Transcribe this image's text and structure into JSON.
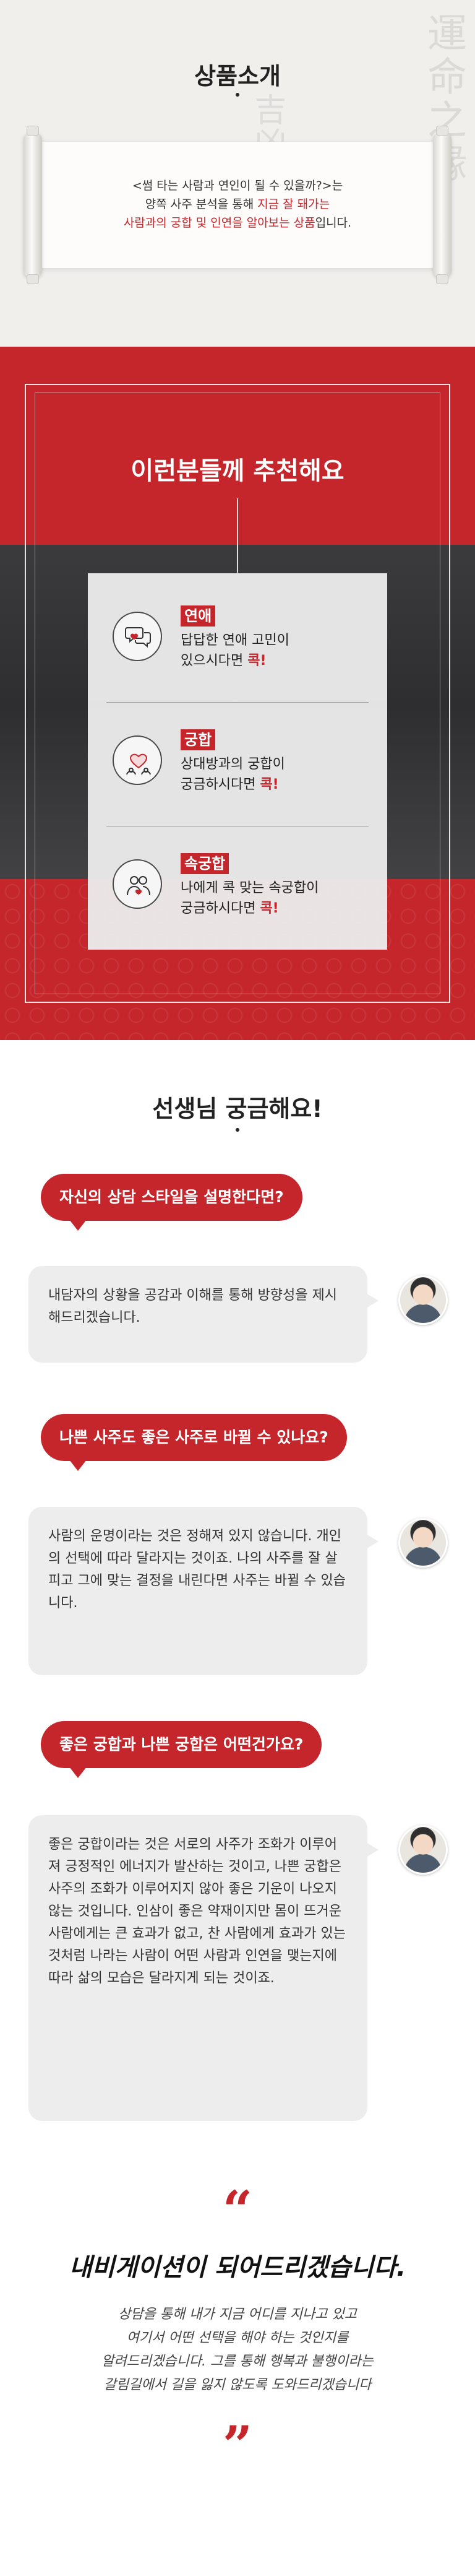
{
  "intro": {
    "title": "상품소개",
    "line1": "<썸 타는 사람과 연인이 될 수 있을까?>는",
    "line2_prefix": "양쪽 사주 분석을 통해 ",
    "line2_highlight": "지금 잘 돼가는",
    "line3_highlight": "사람과의 궁합 및 인연을 알아보는 상품",
    "line3_suffix": "입니다."
  },
  "recommend": {
    "title": "이런분들께 추천해요",
    "items": [
      {
        "label": "연애",
        "line1": "답답한 연애 고민이",
        "line2_prefix": "있으시다면 ",
        "line2_highlight": "콕!"
      },
      {
        "label": "궁합",
        "line1": "상대방과의 궁합이",
        "line2_prefix": "궁금하시다면 ",
        "line2_highlight": "콕!"
      },
      {
        "label": "속궁합",
        "line1": "나에게 콕 맞는 속궁합이",
        "line2_prefix": "궁금하시다면 ",
        "line2_highlight": "콕!"
      }
    ]
  },
  "qa": {
    "title": "선생님 궁금해요!",
    "items": [
      {
        "question": "자신의 상담 스타일을 설명한다면?",
        "answer": "내담자의 상황을 공감과 이해를 통해 방향성을 제시해드리겠습니다."
      },
      {
        "question": "나쁜 사주도 좋은 사주로 바뀔 수 있나요?",
        "answer": "사람의 운명이라는 것은 정해져 있지 않습니다. 개인의 선택에 따라 달라지는 것이죠. 나의 사주를 잘 살피고 그에 맞는 결정을 내린다면 사주는 바뀔 수 있습니다."
      },
      {
        "question": "좋은 궁합과 나쁜 궁합은 어떤건가요?",
        "answer": "좋은 궁합이라는 것은 서로의 사주가 조화가 이루어져 긍정적인 에너지가 발산하는 것이고, 나쁜 궁합은 사주의 조화가 이루어지지 않아 좋은 기운이 나오지 않는 것입니다. 인삼이 좋은 약재이지만 몸이 뜨거운 사람에게는 큰 효과가 없고, 찬 사람에게 효과가 있는 것처럼 나라는 사람이 어떤 사람과 인연을 맺는지에 따라 삶의 모습은 달라지게 되는 것이죠."
      }
    ]
  },
  "closing": {
    "open_quote": "“",
    "close_quote": "”",
    "title": "내비게이션이 되어드리겠습니다.",
    "line1": "상담을 통해 내가 지금 어디를 지나고 있고",
    "line2": "여기서 어떤 선택을 해야 하는 것인지를",
    "line3": "알려드리겠습니다. 그를 통해 행복과 불행이라는",
    "line4": "갈림길에서 길을 잃지 않도록 도와드리겠습니다"
  },
  "colors": {
    "accent": "#c4262c",
    "dark": "#2e2e30",
    "bubble": "#ededed"
  },
  "icons": [
    "chat-hearts-icon",
    "couple-heart-icon",
    "couple-people-icon",
    "teacher-avatar"
  ]
}
